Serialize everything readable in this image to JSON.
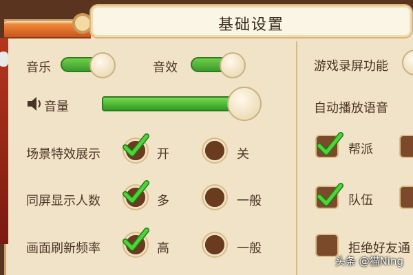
{
  "title": "基础设置",
  "audio": {
    "music_label": "音乐",
    "sfx_label": "音效",
    "volume_label": "音量",
    "music_on": true,
    "sfx_on": true,
    "volume_level": 1.0
  },
  "right_column": {
    "record_label": "游戏录屏功能",
    "autoplay_label": "自动播放语音",
    "options": [
      {
        "label": "帮派",
        "checked": true
      },
      {
        "label": "队伍",
        "checked": true
      },
      {
        "label": "拒绝好友通",
        "checked": false
      }
    ]
  },
  "settings": {
    "scene_effects": {
      "label": "场景特效展示",
      "opt1": "开",
      "opt2": "关",
      "selected": 1
    },
    "screen_count": {
      "label": "同屏显示人数",
      "opt1": "多",
      "opt2": "一般",
      "selected": 1
    },
    "refresh_rate": {
      "label": "画面刷新频率",
      "opt1": "高",
      "opt2": "一般",
      "selected": 1
    }
  },
  "watermark": "头条 @猫Ning",
  "colors": {
    "panel_bg": "#f1e3c7",
    "toggle_green": "#3c9b2c",
    "check_green": "#3fbf2a",
    "checkbox_brown": "#7b4a2a"
  },
  "icons": [
    "speaker-icon",
    "checkmark-icon"
  ]
}
